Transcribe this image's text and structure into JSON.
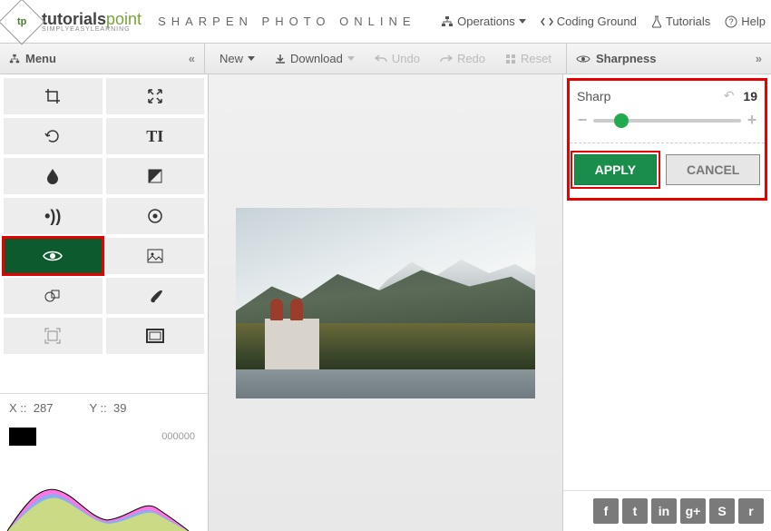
{
  "header": {
    "brand_main": "tutorials",
    "brand_accent": "point",
    "brand_sub": "SIMPLYEASYLEARNING",
    "page_title": "SHARPEN PHOTO ONLINE",
    "nav": {
      "operations": "Operations",
      "coding_ground": "Coding Ground",
      "tutorials": "Tutorials",
      "help": "Help"
    }
  },
  "toolbar": {
    "menu": "Menu",
    "new": "New",
    "download": "Download",
    "undo": "Undo",
    "redo": "Redo",
    "reset": "Reset"
  },
  "sidebar": {
    "tools": [
      {
        "name": "crop-icon"
      },
      {
        "name": "expand-icon"
      },
      {
        "name": "rotate-icon"
      },
      {
        "name": "text-icon"
      },
      {
        "name": "droplet-icon"
      },
      {
        "name": "exposure-icon"
      },
      {
        "name": "vibration-icon"
      },
      {
        "name": "target-icon"
      },
      {
        "name": "eye-icon",
        "active": true
      },
      {
        "name": "image-icon"
      },
      {
        "name": "shapes-overlap-icon"
      },
      {
        "name": "brush-icon"
      },
      {
        "name": "focus-icon"
      },
      {
        "name": "frame-icon"
      }
    ],
    "coords": {
      "x_label": "X ::",
      "x": "287",
      "y_label": "Y ::",
      "y": "39"
    },
    "histo_readout": "000000"
  },
  "panel": {
    "title": "Sharpness",
    "param_label": "Sharp",
    "param_value": "19",
    "slider_percent": 19,
    "apply": "APPLY",
    "cancel": "CANCEL"
  },
  "share": [
    "f",
    "t",
    "in",
    "g+",
    "S",
    "r"
  ]
}
